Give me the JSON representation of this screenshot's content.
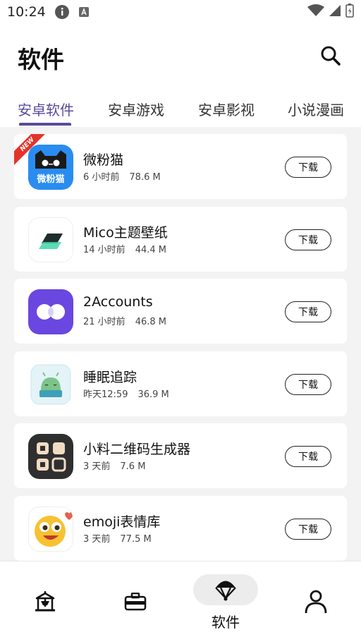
{
  "status": {
    "time": "10:24"
  },
  "header": {
    "title": "软件"
  },
  "tabs": [
    {
      "label": "安卓软件"
    },
    {
      "label": "安卓游戏"
    },
    {
      "label": "安卓影视"
    },
    {
      "label": "小说漫画"
    }
  ],
  "apps": [
    {
      "name": "微粉猫",
      "time": "6 小时前",
      "size": "78.6 M",
      "badge": "NEW",
      "icon": "weifenmao-app-icon",
      "icon_text": "微粉猫",
      "download_label": "下载"
    },
    {
      "name": "Mico主题壁纸",
      "time": "14 小时前",
      "size": "44.4 M",
      "icon": "mico-app-icon",
      "download_label": "下载"
    },
    {
      "name": "2Accounts",
      "time": "21 小时前",
      "size": "46.8 M",
      "icon": "2accounts-app-icon",
      "download_label": "下载"
    },
    {
      "name": "睡眠追踪",
      "time": "昨天12:59",
      "size": "36.9 M",
      "icon": "sleep-tracker-app-icon",
      "download_label": "下载"
    },
    {
      "name": "小料二维码生成器",
      "time": "3 天前",
      "size": "7.6 M",
      "icon": "qr-generator-app-icon",
      "download_label": "下载"
    },
    {
      "name": "emoji表情库",
      "time": "3 天前",
      "size": "77.5 M",
      "icon": "emoji-app-icon",
      "download_label": "下载"
    }
  ],
  "bottom_nav": {
    "items": [
      {
        "icon": "carousel-icon"
      },
      {
        "icon": "toolbox-icon"
      },
      {
        "icon": "parachute-icon",
        "label": "软件",
        "active": true
      },
      {
        "icon": "person-icon"
      }
    ]
  },
  "colors": {
    "accent": "#5a4a99",
    "badge_red": "#e5332a",
    "background": "#f3f3f3"
  }
}
